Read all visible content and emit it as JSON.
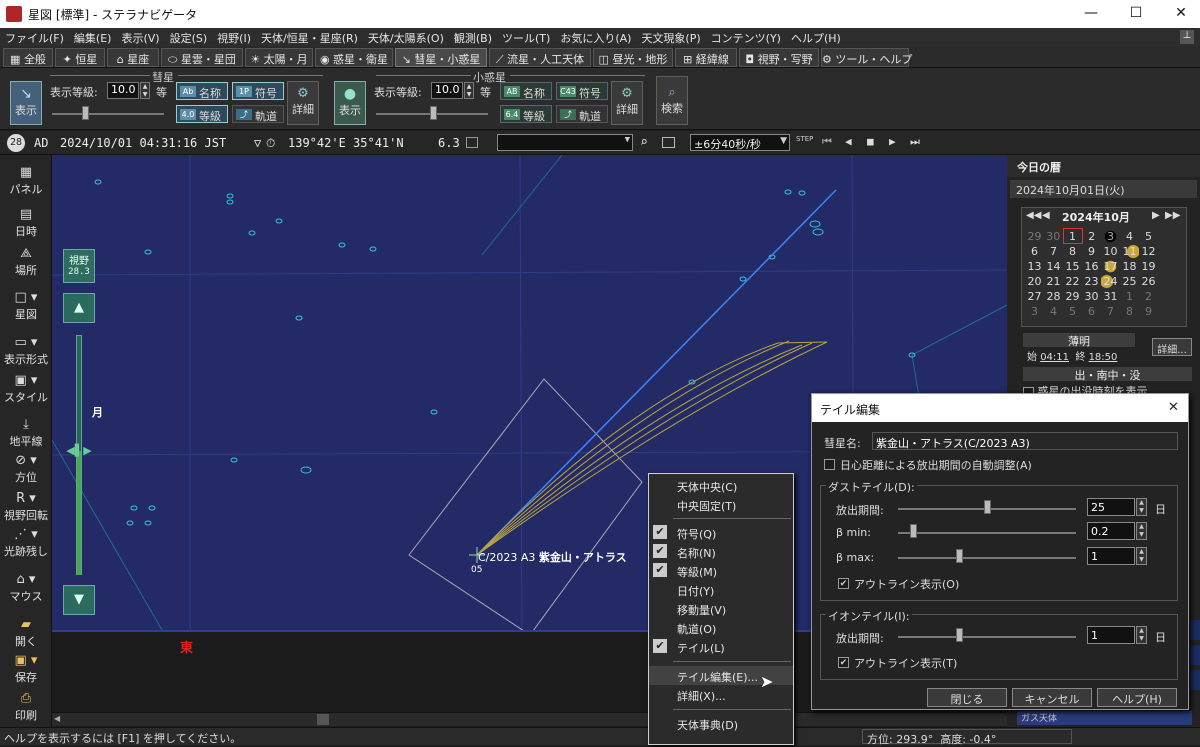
{
  "window": {
    "title": "星図 [標準] - ステラナビゲータ"
  },
  "menu": [
    "ファイル(F)",
    "編集(E)",
    "表示(V)",
    "設定(S)",
    "視野(I)",
    "天体/恒星・星座(R)",
    "天体/太陽系(O)",
    "観測(B)",
    "ツール(T)",
    "お気に入り(A)",
    "天文現象(P)",
    "コンテンツ(Y)",
    "ヘルプ(H)"
  ],
  "tabs": [
    "全般",
    "恒星",
    "星座",
    "星雲・星団",
    "太陽・月",
    "惑星・衛星",
    "彗星・小惑星",
    "流星・人工天体",
    "昼光・地形",
    "経緯線",
    "視野・写野",
    "ツール・ヘルプ"
  ],
  "ribbon": {
    "comet_group": "彗星",
    "asteroid_group": "小惑星",
    "show": "表示",
    "mag_label": "表示等級:",
    "mag_value": "10.0",
    "mag_suffix": "等",
    "name": "名称",
    "symbol": "符号",
    "grade": "等級",
    "orbit": "軌道",
    "detail": "詳細",
    "search": "検索",
    "icon_name": "Ab",
    "icon_symbol": "1P",
    "icon_grade": "4.0",
    "icon_name2": "AB",
    "icon_symbol2": "C43",
    "icon_grade2": "6.4"
  },
  "statusline": {
    "badge": "28",
    "era": "AD",
    "datetime": "2024/10/01 04:31:16 JST",
    "tz_mark": "▽",
    "location": "139°42'E 35°41'N",
    "mag": "6.3",
    "step": "±6分40秒/秒",
    "step_label": "STEP"
  },
  "leftbar": [
    "パネル",
    "日時",
    "場所",
    "星図",
    "表示形式",
    "スタイル",
    "地平線",
    "方位",
    "視野回転",
    "光跡残し",
    "マウス",
    "開く",
    "保存",
    "印刷"
  ],
  "sky": {
    "fov_label": "視野",
    "fov_value": "28.3",
    "moon": "月",
    "east": "東",
    "comet_label": "C/2023 A3",
    "comet_name": "紫金山・アトラス",
    "tick": "05"
  },
  "statusbar": {
    "help": "ヘルプを表示するには [F1] を押してください。",
    "azimuth": "方位: 293.9°",
    "altitude": "高度: -0.4°"
  },
  "right_panel": {
    "title": "今日の暦",
    "date": "2024年10月01日(火)",
    "month": "2024年10月",
    "weeks": [
      [
        "29",
        "30",
        "1",
        "2",
        "3",
        "4",
        "5"
      ],
      [
        "6",
        "7",
        "8",
        "9",
        "10",
        "11",
        "12"
      ],
      [
        "13",
        "14",
        "15",
        "16",
        "17",
        "18",
        "19"
      ],
      [
        "20",
        "21",
        "22",
        "23",
        "24",
        "25",
        "26"
      ],
      [
        "27",
        "28",
        "29",
        "30",
        "31",
        "1",
        "2"
      ],
      [
        "3",
        "4",
        "5",
        "6",
        "7",
        "8",
        "9"
      ]
    ],
    "twilight": "薄明",
    "start_label": "始",
    "start_time": "04:11",
    "end_label": "終",
    "end_time": "18:50",
    "detail": "詳細...",
    "riseset": "出・南中・没",
    "planet_check": "惑星の出没時刻を表示",
    "cut_text": "ガス天体"
  },
  "context_menu": {
    "items": [
      {
        "label": "天体中央(C)",
        "checked": false
      },
      {
        "label": "中央固定(T)",
        "checked": false
      },
      {
        "label": "符号(Q)",
        "checked": true
      },
      {
        "label": "名称(N)",
        "checked": true
      },
      {
        "label": "等級(M)",
        "checked": true
      },
      {
        "label": "日付(Y)",
        "checked": false
      },
      {
        "label": "移動量(V)",
        "checked": false
      },
      {
        "label": "軌道(O)",
        "checked": false
      },
      {
        "label": "テイル(L)",
        "checked": true
      },
      {
        "label": "テイル編集(E)...",
        "checked": false
      },
      {
        "label": "詳細(X)...",
        "checked": false
      },
      {
        "label": "天体事典(D)",
        "checked": false
      }
    ]
  },
  "dialog": {
    "title": "テイル編集",
    "comet_label": "彗星名:",
    "comet_name": "紫金山・アトラス(C/2023 A3)",
    "auto_adjust": "日心距離による放出期間の自動調整(A)",
    "dust_group": "ダストテイル(D):",
    "emit_period": "放出期間:",
    "dust_period_value": "25",
    "day_unit": "日",
    "beta_min": "β min:",
    "beta_min_value": "0.2",
    "beta_max": "β max:",
    "beta_max_value": "1",
    "outline": "アウトライン表示(O)",
    "ion_group": "イオンテイル(I):",
    "ion_period_value": "1",
    "ion_outline": "アウトライン表示(T)",
    "btn_close": "閉じる",
    "btn_cancel": "キャンセル",
    "btn_help": "ヘルプ(H)"
  }
}
